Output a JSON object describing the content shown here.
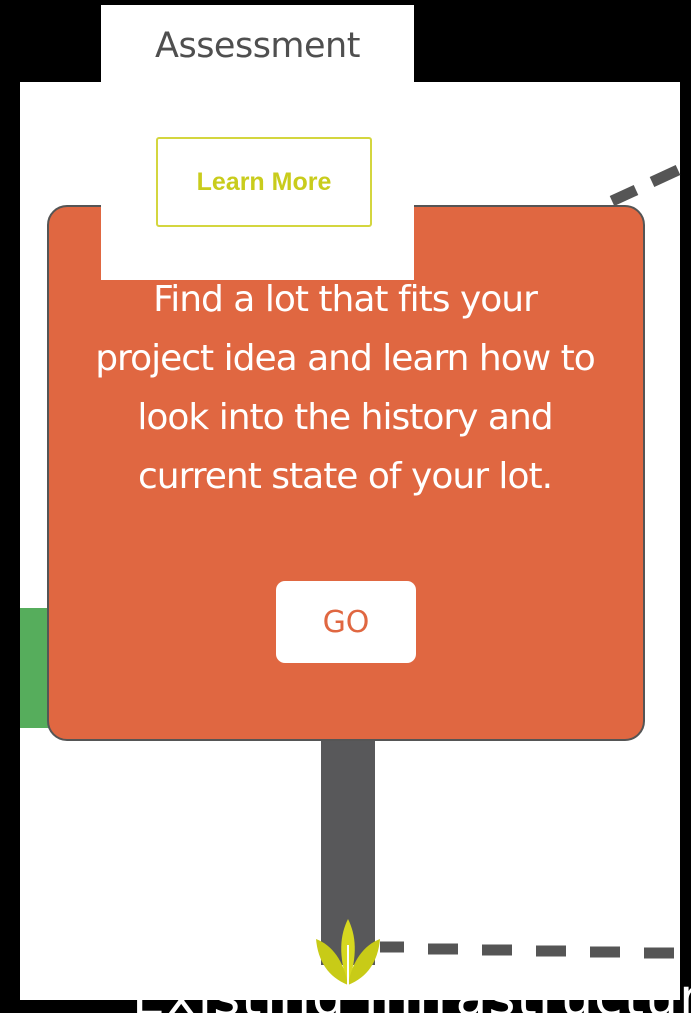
{
  "header": {
    "title": "Assessment",
    "learn_more_label": "Learn More"
  },
  "card": {
    "description": "Find a lot that fits your project idea and learn how to look into the history and current state of your lot.",
    "go_label": "GO"
  },
  "footer": {
    "caption": "Existing Infrastructure"
  },
  "colors": {
    "card": "#e06741",
    "accent": "#c9cc1c",
    "green": "#56ad5c",
    "pole": "#58585a",
    "path": "#555555"
  },
  "icons": {
    "leaf": "leaf-icon"
  }
}
